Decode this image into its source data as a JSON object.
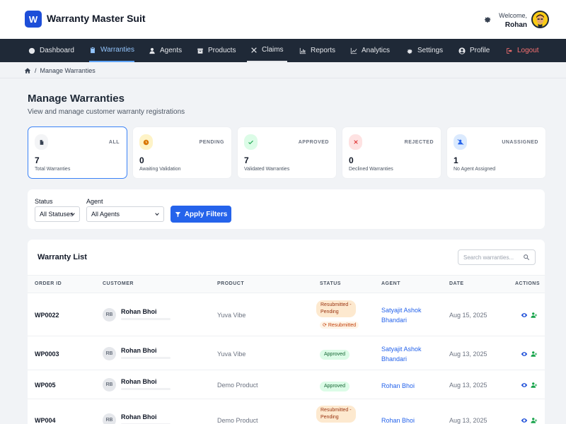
{
  "app": {
    "logo_letter": "W",
    "title": "Warranty Master Suit"
  },
  "user": {
    "welcome": "Welcome,",
    "name": "Rohan"
  },
  "nav": [
    {
      "label": "Dashboard",
      "icon": "dashboard-icon"
    },
    {
      "label": "Warranties",
      "icon": "clipboard-icon",
      "active": true
    },
    {
      "label": "Agents",
      "icon": "user-icon"
    },
    {
      "label": "Products",
      "icon": "box-icon"
    },
    {
      "label": "Claims",
      "icon": "tools-icon"
    },
    {
      "label": "Reports",
      "icon": "bar-chart-icon"
    },
    {
      "label": "Analytics",
      "icon": "line-chart-icon"
    },
    {
      "label": "Settings",
      "icon": "gear-icon"
    },
    {
      "label": "Profile",
      "icon": "profile-circle-icon"
    },
    {
      "label": "Logout",
      "icon": "logout-icon"
    }
  ],
  "breadcrumb": {
    "current": "Manage Warranties",
    "separator": "/"
  },
  "page": {
    "title": "Manage Warranties",
    "subtitle": "View and manage customer warranty registrations"
  },
  "stats": [
    {
      "label": "ALL",
      "value": "7",
      "desc": "Total Warranties",
      "icon": "document-icon"
    },
    {
      "label": "PENDING",
      "value": "0",
      "desc": "Awaiting Validation",
      "icon": "clock-icon"
    },
    {
      "label": "APPROVED",
      "value": "7",
      "desc": "Validated Warranties",
      "icon": "check-icon"
    },
    {
      "label": "REJECTED",
      "value": "0",
      "desc": "Declined Warranties",
      "icon": "x-icon"
    },
    {
      "label": "UNASSIGNED",
      "value": "1",
      "desc": "No Agent Assigned",
      "icon": "user-slash-icon"
    }
  ],
  "filters": {
    "status_label": "Status",
    "status_value": "All Statuses",
    "agent_label": "Agent",
    "agent_value": "All Agents",
    "apply_label": "Apply Filters"
  },
  "list": {
    "title": "Warranty List",
    "search_placeholder": "Search warranties...",
    "columns": [
      "ORDER ID",
      "CUSTOMER",
      "PRODUCT",
      "STATUS",
      "AGENT",
      "DATE",
      "ACTIONS"
    ],
    "rows": [
      {
        "order_id": "WP0022",
        "initials": "RB",
        "customer": "Rohan Bhoi",
        "product": "Yuva Vibe",
        "status": "Resubmitted - Pending",
        "status_line1": "Resubmitted -",
        "status_line2": "Pending",
        "resubmitted": "Resubmitted",
        "agent_line1": "Satyajit Ashok",
        "agent_line2": "Bhandari",
        "date": "Aug 15, 2025"
      },
      {
        "order_id": "WP0003",
        "initials": "RB",
        "customer": "Rohan Bhoi",
        "product": "Yuva Vibe",
        "status": "Approved",
        "agent_line1": "Satyajit Ashok",
        "agent_line2": "Bhandari",
        "date": "Aug 13, 2025"
      },
      {
        "order_id": "WP005",
        "initials": "RB",
        "customer": "Rohan Bhoi",
        "product": "Demo Product",
        "status": "Approved",
        "agent_line1": "Rohan Bhoi",
        "agent_line2": "",
        "date": "Aug 13, 2025"
      },
      {
        "order_id": "WP004",
        "initials": "RB",
        "customer": "Rohan Bhoi",
        "product": "Demo Product",
        "status": "Resubmitted - Pending",
        "status_line1": "Resubmitted -",
        "status_line2": "Pending",
        "agent_line1": "Rohan Bhoi",
        "agent_line2": "",
        "date": "Aug 13, 2025"
      }
    ]
  },
  "colors": {
    "primary": "#2563eb",
    "nav_bg": "#1f2937",
    "logout": "#f87171",
    "approved": "#166534",
    "pending": "#9a3412"
  }
}
